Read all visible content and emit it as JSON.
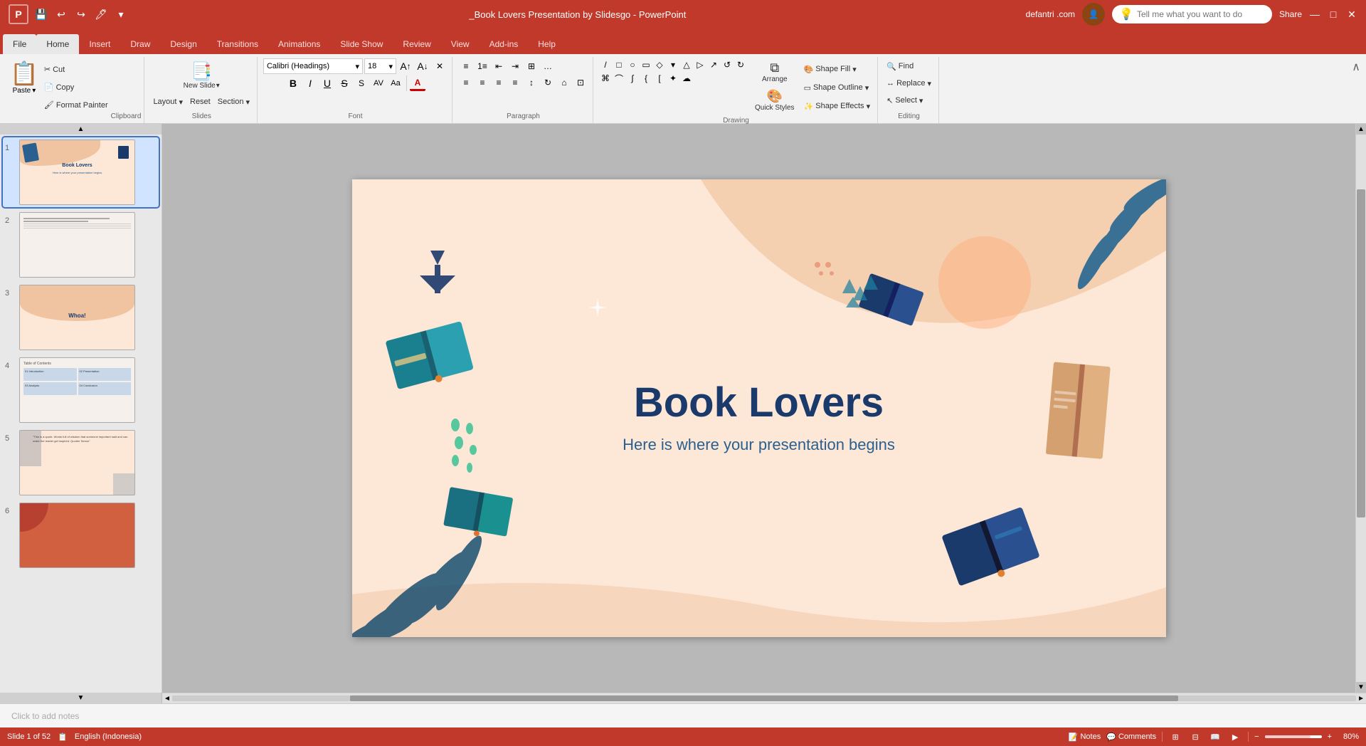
{
  "window": {
    "title": "_Book Lovers Presentation by Slidesgo - PowerPoint",
    "user": "defantri .com"
  },
  "qat": {
    "save": "💾",
    "undo": "↩",
    "redo": "↪",
    "customize": "✏️",
    "dropdown": "▾"
  },
  "tabs": [
    {
      "label": "File",
      "active": false
    },
    {
      "label": "Home",
      "active": true
    },
    {
      "label": "Insert",
      "active": false
    },
    {
      "label": "Draw",
      "active": false
    },
    {
      "label": "Design",
      "active": false
    },
    {
      "label": "Transitions",
      "active": false
    },
    {
      "label": "Animations",
      "active": false
    },
    {
      "label": "Slide Show",
      "active": false
    },
    {
      "label": "Review",
      "active": false
    },
    {
      "label": "View",
      "active": false
    },
    {
      "label": "Add-ins",
      "active": false
    },
    {
      "label": "Help",
      "active": false
    }
  ],
  "ribbon": {
    "clipboard": {
      "label": "Clipboard",
      "paste_label": "Paste",
      "sub_buttons": [
        "Cut",
        "Copy",
        "Format Painter"
      ]
    },
    "slides": {
      "label": "Slides",
      "new_slide": "New Slide",
      "layout": "Layout",
      "reset": "Reset",
      "section": "Section"
    },
    "font": {
      "label": "Font",
      "font_name": "Calibri (Headings)",
      "font_size": "18",
      "bold": "B",
      "italic": "I",
      "underline": "U",
      "strikethrough": "S",
      "size_up": "A↑",
      "size_down": "A↓",
      "clear": "✕",
      "shadow": "S",
      "char_spacing": "AV",
      "change_case": "Aa",
      "font_color": "A"
    },
    "paragraph": {
      "label": "Paragraph"
    },
    "drawing": {
      "label": "Drawing",
      "arrange": "Arrange",
      "quick_styles": "Quick Styles",
      "shape_fill": "Shape Fill",
      "shape_outline": "Shape Outline",
      "shape_effects": "Shape Effects"
    },
    "editing": {
      "label": "Editing",
      "find": "Find",
      "replace": "Replace",
      "select": "Select"
    }
  },
  "tell_me": {
    "placeholder": "Tell me what you want to do"
  },
  "slide": {
    "title": "Book Lovers",
    "subtitle": "Here is where your presentation begins",
    "total": "52"
  },
  "slides_panel": [
    {
      "num": "1",
      "active": true
    },
    {
      "num": "2",
      "active": false
    },
    {
      "num": "3",
      "active": false
    },
    {
      "num": "4",
      "active": false
    },
    {
      "num": "5",
      "active": false
    },
    {
      "num": "6",
      "active": false
    }
  ],
  "status": {
    "slide_info": "Slide 1 of 52",
    "language": "English (Indonesia)",
    "notes": "Notes",
    "comments": "Comments",
    "zoom": "80%"
  },
  "notes_placeholder": "Click to add notes",
  "share_label": "Share"
}
